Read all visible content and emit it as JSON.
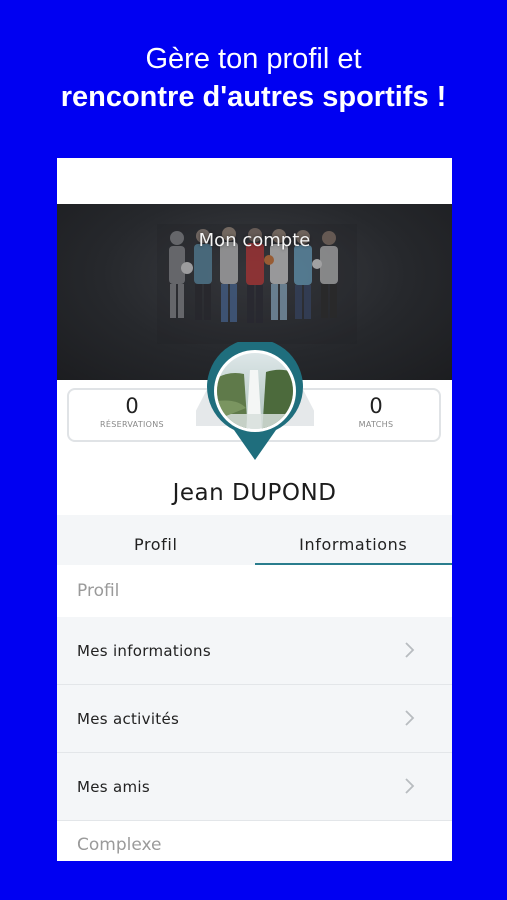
{
  "promo": {
    "line1": "Gère ton profil et",
    "line2": "rencontre d'autres sportifs !"
  },
  "header": {
    "title": "Mon compte"
  },
  "stats": {
    "reservations": {
      "value": "0",
      "label": "RÉSERVATIONS"
    },
    "matchs": {
      "value": "0",
      "label": "MATCHS"
    }
  },
  "profile": {
    "name": "Jean  DUPOND"
  },
  "tabs": [
    {
      "label": "Profil",
      "active": false
    },
    {
      "label": "Informations",
      "active": true
    }
  ],
  "sections": {
    "profil": "Profil",
    "complexe": "Complexe"
  },
  "menu": [
    {
      "label": "Mes informations",
      "icon": "chevron-right-icon"
    },
    {
      "label": "Mes activités",
      "icon": "chevron-right-icon"
    },
    {
      "label": "Mes amis",
      "icon": "chevron-right-icon"
    }
  ],
  "colors": {
    "background": "#0000F2",
    "accent": "#1f6e7d"
  }
}
